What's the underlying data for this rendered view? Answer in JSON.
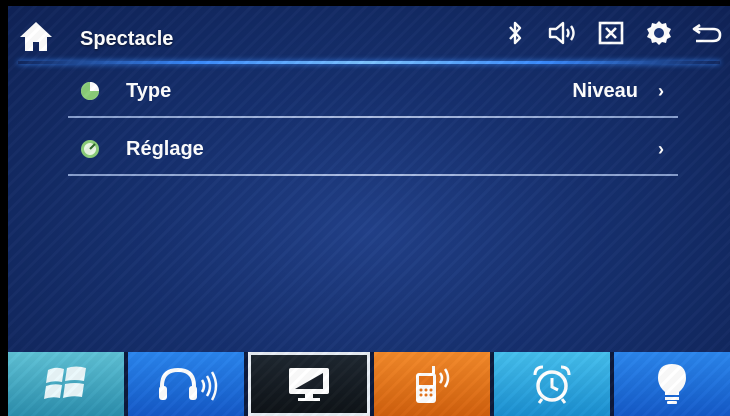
{
  "header": {
    "title": "Spectacle",
    "icons": [
      "home-icon",
      "bluetooth-icon",
      "volume-icon",
      "close-box-icon",
      "settings-icon",
      "back-icon"
    ]
  },
  "menu": {
    "items": [
      {
        "label": "Type",
        "value": "Niveau",
        "chevron": "›",
        "icon": "pie-chart-icon"
      },
      {
        "label": "Réglage",
        "value": "",
        "chevron": "›",
        "icon": "gauge-icon"
      }
    ]
  },
  "dock": {
    "tiles": [
      {
        "icon": "windows-icon",
        "color": "#3fa9c6"
      },
      {
        "icon": "headphones-icon",
        "color": "#1f6fe0"
      },
      {
        "icon": "monitor-icon",
        "color": "#151b22",
        "selected": true
      },
      {
        "icon": "phone-bluetooth-icon",
        "color": "#e5741b"
      },
      {
        "icon": "alarm-clock-icon",
        "color": "#2fa8e0"
      },
      {
        "icon": "light-bulb-icon",
        "color": "#1f6fe0"
      }
    ]
  },
  "colors": {
    "background": "#16306f",
    "accent_line": "#3a8bff",
    "text": "#ffffff"
  }
}
